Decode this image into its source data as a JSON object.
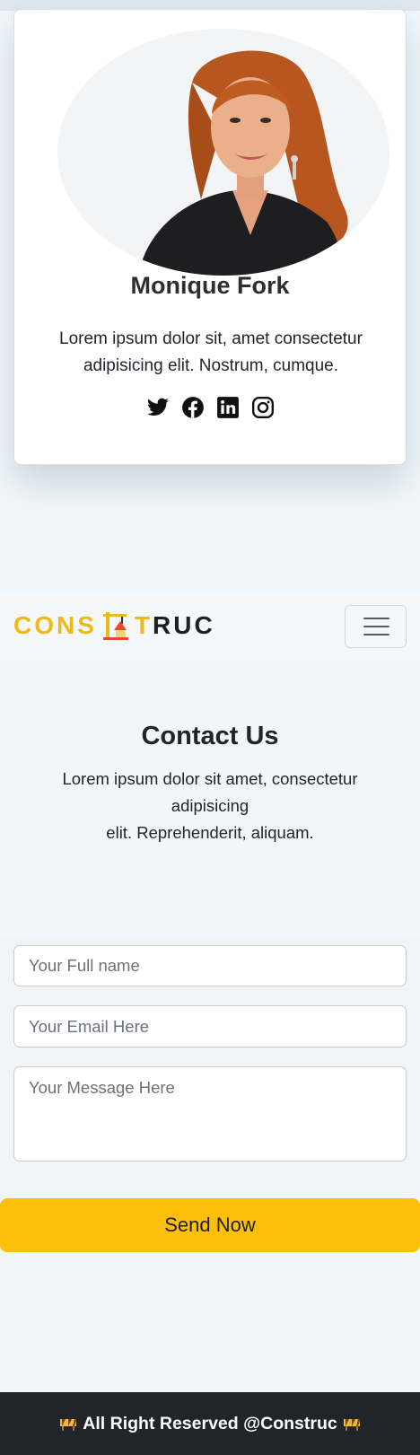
{
  "team_card": {
    "name": "Monique Fork",
    "description": "Lorem ipsum dolor sit, amet consectetur adipisicing elit. Nostrum, cumque.",
    "photo": "portrait of smiling red-haired woman in black shirt",
    "socials": [
      "twitter-icon",
      "facebook-icon",
      "linkedin-icon",
      "instagram-icon"
    ]
  },
  "navbar": {
    "brand_left": "CONS",
    "brand_mid": "T",
    "brand_right": "RUC",
    "brand_logo": "crane-icon",
    "toggler": "hamburger-menu-icon"
  },
  "contact": {
    "title": "Contact Us",
    "description_line1": "Lorem ipsum dolor sit amet, consectetur adipisicing",
    "description_line2": "elit. Reprehenderit, aliquam.",
    "name_placeholder": "Your Full name",
    "email_placeholder": "Your Email Here",
    "message_placeholder": "Your Message Here",
    "send_label": "Send Now"
  },
  "footer": {
    "text": "All Right Reserved @Construc",
    "icon": "construction-barrier-icon"
  },
  "colors": {
    "accent_yellow": "#fcbf0b",
    "brand_yellow": "#f0b91b",
    "footer_bg": "#212529",
    "page_bg": "#f0f7fc"
  }
}
